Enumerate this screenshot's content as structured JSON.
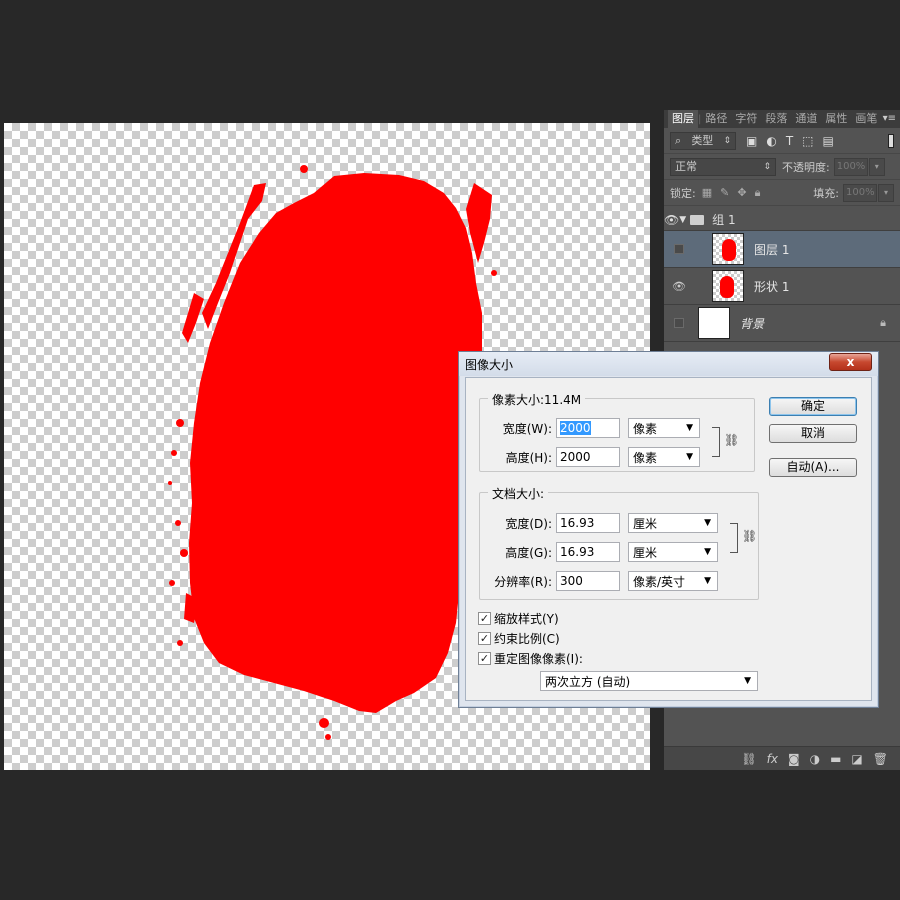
{
  "layers_panel": {
    "tabs": [
      "图层",
      "路径",
      "字符",
      "段落",
      "通道",
      "属性",
      "画笔"
    ],
    "filter_kind": "类型",
    "blend_mode": "正常",
    "opacity_label": "不透明度:",
    "opacity_value": "100%",
    "lock_label": "锁定:",
    "fill_label": "填充:",
    "fill_value": "100%",
    "group_name": "组 1",
    "layers": [
      {
        "name": "图层 1",
        "selected": true,
        "visible": false
      },
      {
        "name": "形状 1",
        "selected": false,
        "visible": true
      },
      {
        "name": "背景",
        "selected": false,
        "visible": false
      }
    ]
  },
  "dialog": {
    "title": "图像大小",
    "close_label": "x",
    "pixel_dims": {
      "legend": "像素大小:11.4M",
      "width_label": "宽度(W):",
      "width_value": "2000",
      "width_unit": "像素",
      "height_label": "高度(H):",
      "height_value": "2000",
      "height_unit": "像素"
    },
    "doc_size": {
      "legend": "文档大小:",
      "width_label": "宽度(D):",
      "width_value": "16.93",
      "width_unit": "厘米",
      "height_label": "高度(G):",
      "height_value": "16.93",
      "height_unit": "厘米",
      "resolution_label": "分辨率(R):",
      "resolution_value": "300",
      "resolution_unit": "像素/英寸"
    },
    "checkboxes": [
      {
        "label": "缩放样式(Y)",
        "checked": true
      },
      {
        "label": "约束比例(C)",
        "checked": true
      },
      {
        "label": "重定图像像素(I):",
        "checked": true
      }
    ],
    "resample_method": "两次立方 (自动)",
    "buttons": {
      "ok": "确定",
      "cancel": "取消",
      "auto": "自动(A)..."
    }
  },
  "colors": {
    "paint": "#ff0000",
    "app_bg": "#282828",
    "panel_bg": "#535353",
    "selection": "#3399ff"
  }
}
